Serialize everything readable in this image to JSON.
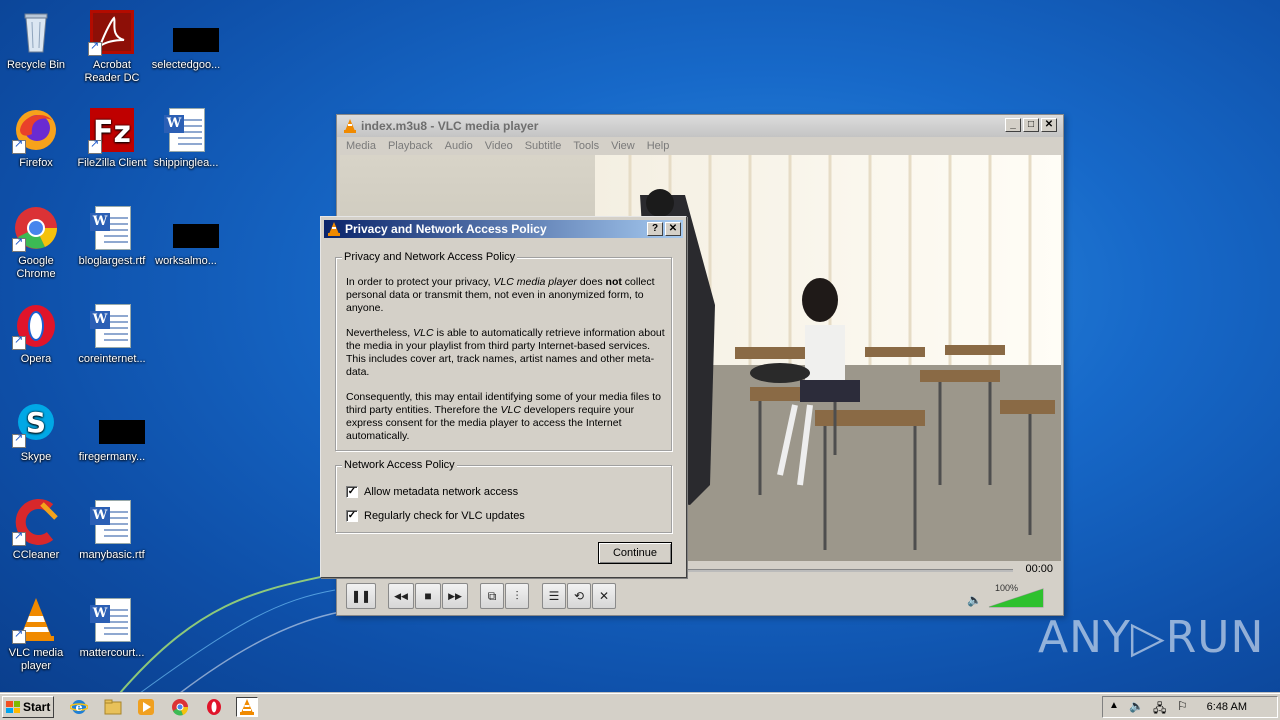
{
  "desktop": {
    "icons": [
      {
        "label": "Recycle Bin",
        "icon": "recycle-bin-icon"
      },
      {
        "label": "Acrobat Reader DC",
        "icon": "acrobat-reader-icon"
      },
      {
        "label": "selectedgoo...",
        "icon": "redacted-file-icon"
      },
      {
        "label": "Firefox",
        "icon": "firefox-icon"
      },
      {
        "label": "FileZilla Client",
        "icon": "filezilla-icon"
      },
      {
        "label": "shippinglea...",
        "icon": "word-doc-icon"
      },
      {
        "label": "Google Chrome",
        "icon": "chrome-icon"
      },
      {
        "label": "bloglargest.rtf",
        "icon": "word-doc-icon"
      },
      {
        "label": "worksalmo...",
        "icon": "redacted-file-icon"
      },
      {
        "label": "Opera",
        "icon": "opera-icon"
      },
      {
        "label": "coreinternet...",
        "icon": "word-doc-icon"
      },
      {
        "label": "Skype",
        "icon": "skype-icon"
      },
      {
        "label": "firegermany...",
        "icon": "redacted-file-icon"
      },
      {
        "label": "CCleaner",
        "icon": "ccleaner-icon"
      },
      {
        "label": "manybasic.rtf",
        "icon": "word-doc-icon"
      },
      {
        "label": "VLC media player",
        "icon": "vlc-icon"
      },
      {
        "label": "mattercourt...",
        "icon": "word-doc-icon"
      }
    ]
  },
  "vlc": {
    "title": "index.m3u8 - VLC media player",
    "menu": [
      "Media",
      "Playback",
      "Audio",
      "Video",
      "Subtitle",
      "Tools",
      "View",
      "Help"
    ],
    "time": "00:00",
    "volume_label": "100%",
    "volume_level": 1.0
  },
  "dialog": {
    "title": "Privacy and Network Access Policy",
    "help_btn": "?",
    "close_btn": "✕",
    "group1_title": "Privacy and Network Access Policy",
    "p1_a": "In order to protect your privacy, ",
    "p1_em": "VLC media player",
    "p1_b": " does ",
    "p1_strong": "not",
    "p1_c": " collect personal data or transmit them, not even in anonymized form, to anyone.",
    "p2_a": "Nevertheless, ",
    "p2_em": "VLC",
    "p2_b": " is able to automatically retrieve information about the media in your playlist from third party Internet-based services. This includes cover art, track names, artist names and other meta-data.",
    "p3_a": "Consequently, this may entail identifying some of your media files to third party entities. Therefore the ",
    "p3_em": "VLC",
    "p3_b": " developers require your express consent for the media player to access the Internet automatically.",
    "group2_title": "Network Access Policy",
    "check1": "Allow metadata network access",
    "check2": "Regularly check for VLC updates",
    "check_mark": "✓",
    "continue": "Continue"
  },
  "taskbar": {
    "start": "Start",
    "clock": "6:48 AM"
  },
  "watermark": "ANY▷RUN"
}
